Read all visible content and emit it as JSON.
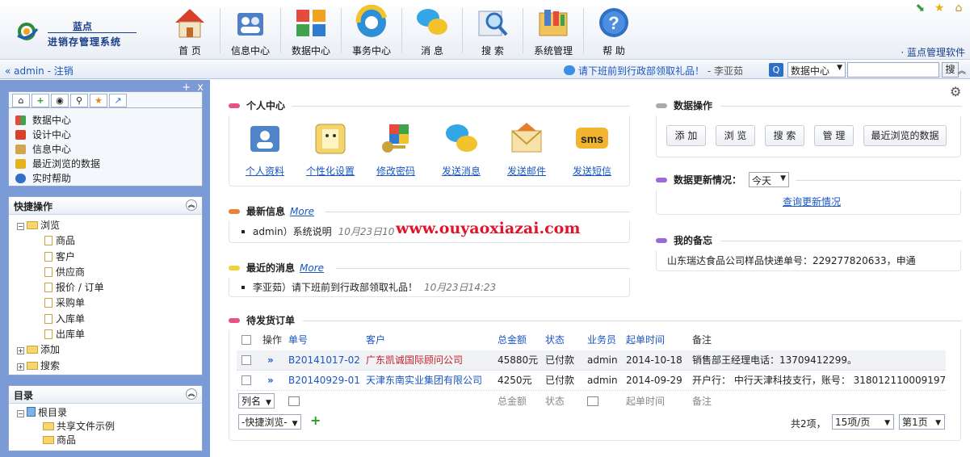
{
  "app": {
    "logo_line1": "蓝点",
    "logo_line2": "进销存管理系统",
    "software_name": "· 蓝点管理软件"
  },
  "topnav": [
    {
      "label": "首 页",
      "icon": "home-icon"
    },
    {
      "label": "信息中心",
      "icon": "info-center-icon"
    },
    {
      "label": "数据中心",
      "icon": "data-center-icon"
    },
    {
      "label": "事务中心",
      "icon": "affairs-center-icon"
    },
    {
      "label": "消 息",
      "icon": "message-icon"
    },
    {
      "label": "搜 索",
      "icon": "search-icon"
    },
    {
      "label": "系统管理",
      "icon": "system-admin-icon"
    },
    {
      "label": "帮 助",
      "icon": "help-icon"
    }
  ],
  "userbar": {
    "user": "« admin - 注销",
    "notice": "请下班前到行政部领取礼品！",
    "notice_from": "- 李亚茹",
    "search_scope": "数据中心",
    "search_button": "搜"
  },
  "sidebar": {
    "controls": "+ x",
    "quick_links": [
      "数据中心",
      "设计中心",
      "信息中心",
      "最近浏览的数据",
      "实时帮助"
    ],
    "quick_ops_title": "快捷操作",
    "tree": {
      "browse": "浏览",
      "browse_items": [
        "商品",
        "客户",
        "供应商",
        "报价 / 订单",
        "采购单",
        "入库单",
        "出库单"
      ],
      "add": "添加",
      "search": "搜索"
    },
    "dir_title": "目录",
    "dir": {
      "root": "根目录",
      "items": [
        "共享文件示例",
        "商品"
      ]
    }
  },
  "personal": {
    "title": "个人中心",
    "items": [
      {
        "label": "个人资料",
        "icon": "profile-icon"
      },
      {
        "label": "个性化设置",
        "icon": "personalize-icon"
      },
      {
        "label": "修改密码",
        "icon": "keys-icon"
      },
      {
        "label": "发送消息",
        "icon": "chat-bubbles-icon"
      },
      {
        "label": "发送邮件",
        "icon": "envelope-icon"
      },
      {
        "label": "发送短信",
        "icon": "sms-icon"
      }
    ]
  },
  "latest_info": {
    "title": "最新信息",
    "more": "More",
    "items": [
      {
        "text": "admin）系统说明",
        "time": "10月23日10"
      }
    ]
  },
  "recent_msgs": {
    "title": "最近的消息",
    "more": "More",
    "items": [
      {
        "text": "李亚茹）请下班前到行政部领取礼品！",
        "time": "10月23日14:23"
      }
    ]
  },
  "data_ops": {
    "title": "数据操作",
    "buttons": [
      "添 加",
      "浏 览",
      "搜 索",
      "管 理",
      "最近浏览的数据"
    ]
  },
  "data_update": {
    "title": "数据更新情况：",
    "period": "今天",
    "link": "查询更新情况"
  },
  "memo": {
    "title": "我的备忘",
    "text": "山东瑞达食品公司样品快递单号：229277820633，申通"
  },
  "orders": {
    "title": "待发货订单",
    "headers": [
      "操作",
      "单号",
      "客户",
      "总金额",
      "状态",
      "业务员",
      "起单时间",
      "备注"
    ],
    "rows": [
      {
        "op": "»",
        "no": "B20141017-02",
        "customer": "广东凯诚国际顾问公司",
        "amount": "45880元",
        "status": "已付款",
        "staff": "admin",
        "date": "2014-10-18",
        "note": "销售部王经理电话：13709412299。"
      },
      {
        "op": "»",
        "no": "B20140929-01",
        "customer": "天津东南实业集团有限公司",
        "amount": "4250元",
        "status": "已付款",
        "staff": "admin",
        "date": "2014-09-29",
        "note": "开户行： 中行天津科技支行，账号： 318012110009197"
      }
    ],
    "footer": {
      "colname": "列名",
      "amount": "总金额",
      "status": "状态",
      "date": "起单时间",
      "note": "备注"
    },
    "quick_browse": "-快捷浏览-",
    "total": "共2项，",
    "per_page": "15项/页",
    "page": "第1页"
  },
  "watermark": "www.ouyaoxiazai.com",
  "colors": {
    "sidebar_bg": "#7a9bd6",
    "link": "#1a56c2",
    "accent_pink": "#e8508a"
  }
}
